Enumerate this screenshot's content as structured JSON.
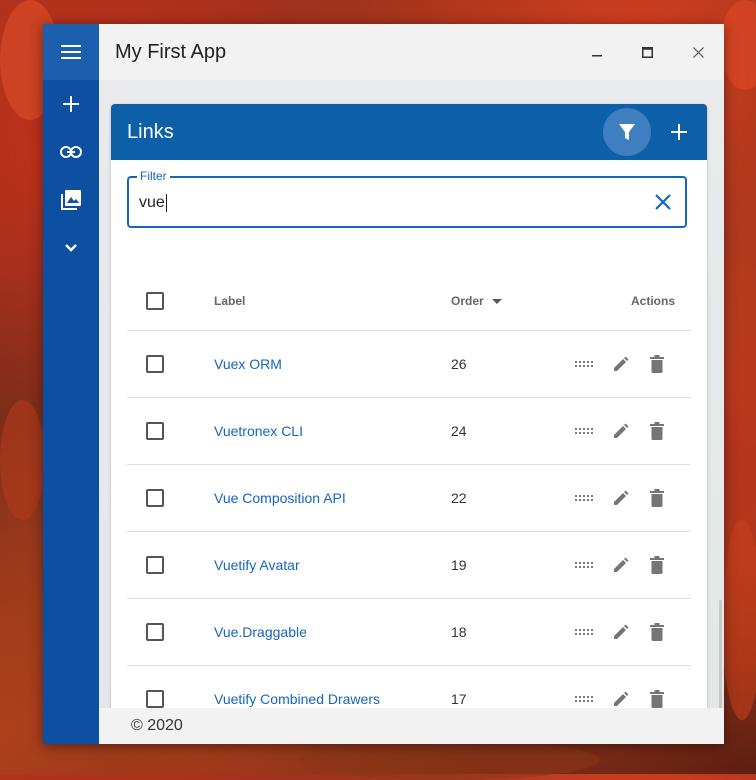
{
  "window": {
    "title": "My First App",
    "controls": {
      "minimize": "_",
      "maximize": "□",
      "close": "×"
    }
  },
  "nav_rail": {
    "items": [
      {
        "name": "menu-icon"
      },
      {
        "name": "plus-icon"
      },
      {
        "name": "link-icon"
      },
      {
        "name": "photo-library-icon"
      },
      {
        "name": "chevron-down-icon"
      }
    ]
  },
  "card": {
    "title": "Links",
    "filter_icon": "filter-icon",
    "add_icon": "plus-icon"
  },
  "filter": {
    "label": "Filter",
    "value": "vue"
  },
  "table": {
    "headers": {
      "label": "Label",
      "order": "Order",
      "actions": "Actions"
    },
    "rows": [
      {
        "label": "Vuex ORM",
        "order": "26"
      },
      {
        "label": "Vuetronex CLI",
        "order": "24"
      },
      {
        "label": "Vue Composition API",
        "order": "22"
      },
      {
        "label": "Vuetify Avatar",
        "order": "19"
      },
      {
        "label": "Vue.Draggable",
        "order": "18"
      },
      {
        "label": "Vuetify Combined Drawers",
        "order": "17"
      }
    ]
  },
  "footer": {
    "text": "© 2020"
  },
  "colors": {
    "primary": "#0d5fa8",
    "rail": "#0d4fa0",
    "link": "#1565c0"
  }
}
